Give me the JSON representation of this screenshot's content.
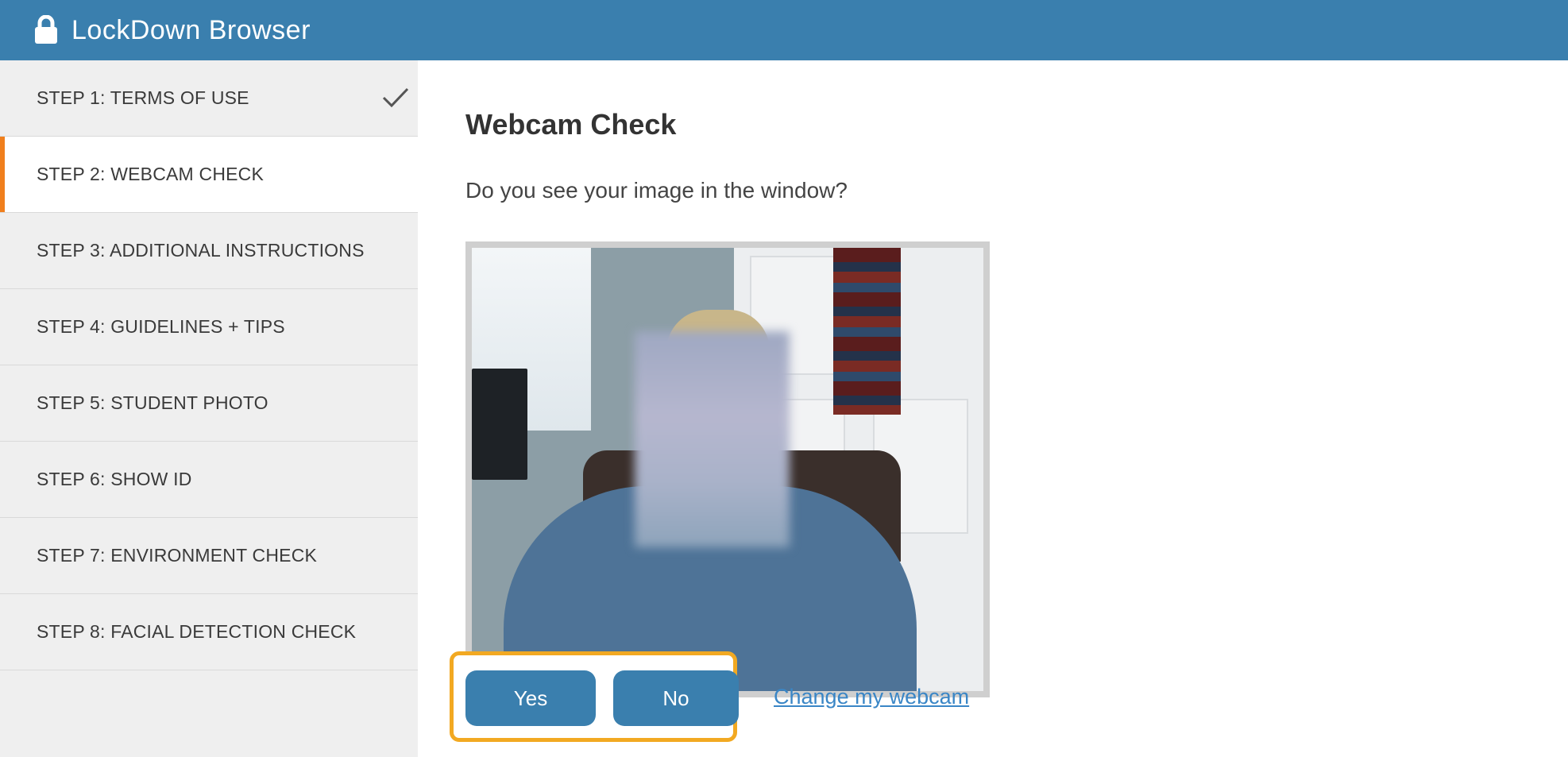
{
  "app": {
    "title": "LockDown Browser",
    "icon": "lock-icon"
  },
  "sidebar": {
    "steps": [
      {
        "label": "STEP 1: TERMS OF USE",
        "completed": true
      },
      {
        "label": "STEP 2: WEBCAM CHECK",
        "active": true
      },
      {
        "label": "STEP 3: ADDITIONAL INSTRUCTIONS"
      },
      {
        "label": "STEP 4: GUIDELINES + TIPS"
      },
      {
        "label": "STEP 5: STUDENT PHOTO"
      },
      {
        "label": "STEP 6: SHOW ID"
      },
      {
        "label": "STEP 7: ENVIRONMENT CHECK"
      },
      {
        "label": "STEP 8: FACIAL DETECTION CHECK"
      }
    ]
  },
  "main": {
    "title": "Webcam Check",
    "question": "Do you see your image in the window?",
    "yes_label": "Yes",
    "no_label": "No",
    "change_webcam_label": "Change my webcam"
  },
  "colors": {
    "header": "#3a7fae",
    "active_step_accent": "#f07f1d",
    "button": "#3a7fae",
    "highlight": "#f2a922",
    "link": "#3a86c6"
  }
}
